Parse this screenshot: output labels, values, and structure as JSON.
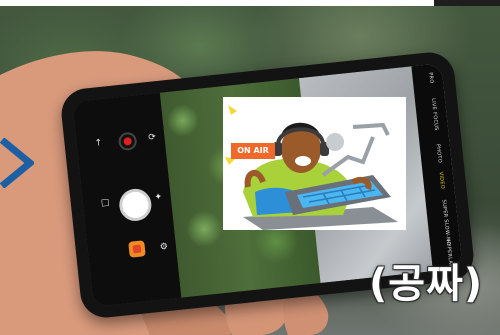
{
  "cartoon": {
    "badge_text": "ON AIR"
  },
  "phone": {
    "side_panel_items": [
      "PRO",
      "LIVE FOCUS",
      "PHOTO",
      "VIDEO",
      "SUPER SLOW-MO",
      "HYPERLAPSE"
    ],
    "highlighted_item": "VIDEO",
    "accent_color": "#e8d030",
    "record_color": "#e02020"
  },
  "overlay": {
    "caption": "(공짜)"
  },
  "icons": {
    "left_arrow": "chevron-right-icon",
    "settings": "gear-icon",
    "record": "record-icon",
    "shutter": "shutter-icon",
    "gallery": "gallery-icon"
  }
}
